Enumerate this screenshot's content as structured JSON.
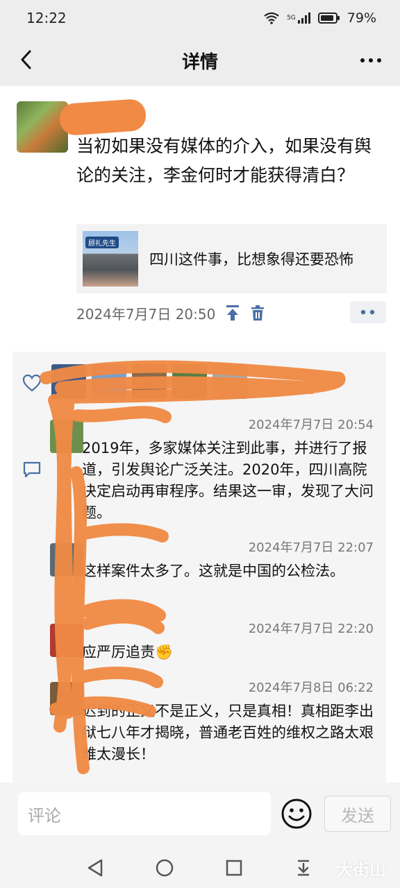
{
  "status_bar": {
    "time": "12:22",
    "network": "5G",
    "battery": "79%",
    "icons": [
      "wifi-icon",
      "signal-icon",
      "battery-icon"
    ]
  },
  "nav": {
    "title": "详情",
    "back_icon": "chevron-left-icon",
    "more_icon": "more-icon"
  },
  "post": {
    "text": "当初如果没有媒体的介入，如果没有舆论的关注，李金何时才能获得清白？",
    "link_card": {
      "thumbnail_label": "顾礼先生",
      "title": "四川这件事，比想象得还要恐怖"
    },
    "time": "2024年7月7日 20:50",
    "actions": [
      "pin-icon",
      "delete-icon",
      "more-dots-icon"
    ],
    "accent_color": "#4a6fa5"
  },
  "comments": [
    {
      "time": "2024年7月7日 20:54",
      "text": "2019年，多家媒体关注到此事，并进行了报道，引发舆论广泛关注。2020年，四川高院决定启动再审程序。结果这一审，发现了大问题。"
    },
    {
      "time": "2024年7月7日 22:07",
      "text": "这样案件太多了。这就是中国的公检法。"
    },
    {
      "time": "2024年7月7日 22:20",
      "text": "应严厉追责✊"
    },
    {
      "time": "2024年7月8日 06:22",
      "text": "迟到的正义不是正义，只是真相！真相距李出狱七八年才揭晓，普通老百姓的维权之路太艰难太漫长！"
    }
  ],
  "input": {
    "placeholder": "评论",
    "send_label": "发送",
    "emoji_icon": "emoji-icon"
  },
  "system_nav": [
    "back-triangle-icon",
    "home-circle-icon",
    "recents-square-icon",
    "download-icon"
  ],
  "watermark": "大街山"
}
